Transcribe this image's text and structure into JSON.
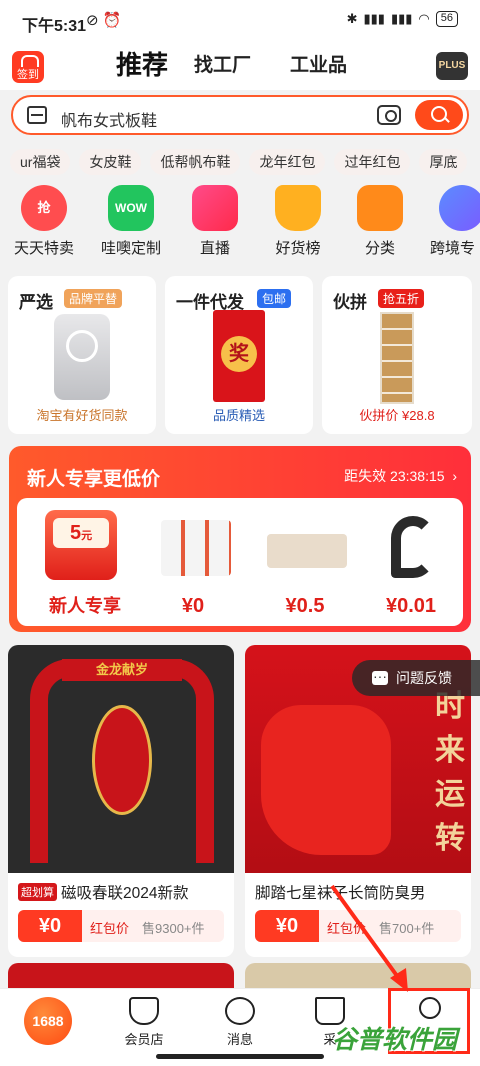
{
  "status": {
    "time": "下午5:31",
    "battery": "56"
  },
  "header": {
    "signin_label": "签到",
    "tabs": [
      "推荐",
      "找工厂",
      "工业品"
    ],
    "plus": "PLUS"
  },
  "search": {
    "text": "帆布女式板鞋"
  },
  "chips": [
    "ur福袋",
    "女皮鞋",
    "低帮帆布鞋",
    "龙年红包",
    "过年红包",
    "厚底"
  ],
  "categories": [
    {
      "label": "天天特卖",
      "icon": "抢"
    },
    {
      "label": "哇噢定制",
      "icon": "WOW"
    },
    {
      "label": "直播",
      "icon": ""
    },
    {
      "label": "好货榜",
      "icon": ""
    },
    {
      "label": "分类",
      "icon": ""
    },
    {
      "label": "跨境专"
    }
  ],
  "cards": [
    {
      "title": "严选",
      "badge": "品牌平替",
      "caption": "淘宝有好货同款"
    },
    {
      "title": "一件代发",
      "badge": "包邮",
      "caption": "品质精选"
    },
    {
      "title": "伙拼",
      "badge": "抢五折",
      "caption": "伙拼价 ¥28.8"
    }
  ],
  "newcomer": {
    "title": "新人专享更低价",
    "countdown": "距失效 23:38:15",
    "coupon_value": "5",
    "coupon_unit": "元",
    "coupon_label": "新人专享",
    "prices": [
      "¥0",
      "¥0.5",
      "¥0.01"
    ]
  },
  "products": [
    {
      "tag": "超划算",
      "name": "磁吸春联2024新款",
      "price": "¥0",
      "hb": "红包价",
      "sold": "售9300+件"
    },
    {
      "name": "脚踏七星袜子长筒防臭男",
      "price": "¥0",
      "hb": "红包价",
      "sold": "售700+件",
      "img_text": "时来运转"
    }
  ],
  "feedback": "问题反馈",
  "bottom_nav": [
    "1688",
    "会员店",
    "消息",
    "采",
    ""
  ],
  "watermark": "谷普软件园"
}
